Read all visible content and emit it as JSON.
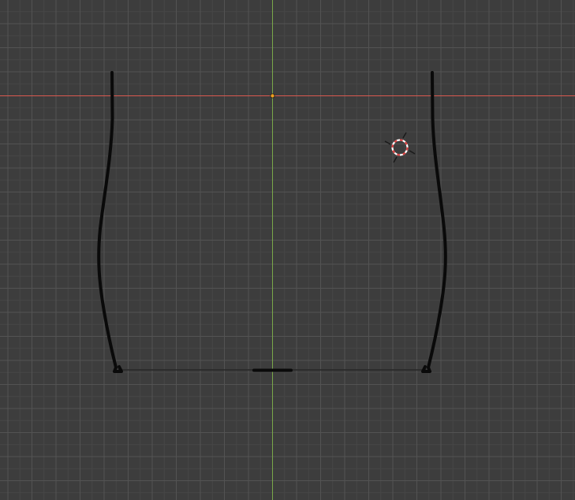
{
  "viewport": {
    "background_color": "#3d3d3d",
    "grid_color": "#535353",
    "grid_minor_color": "#474747"
  },
  "axes": {
    "x_axis_color": "#d9584f",
    "y_axis_color": "#7aa84a",
    "origin_color": "#f0a020"
  },
  "cursor_3d": {
    "icon": "crosshair-target-icon",
    "colors": [
      "#ffffff",
      "#d94040"
    ]
  },
  "mesh": {
    "color": "#0a0a0a",
    "edge_color": "#262626"
  }
}
